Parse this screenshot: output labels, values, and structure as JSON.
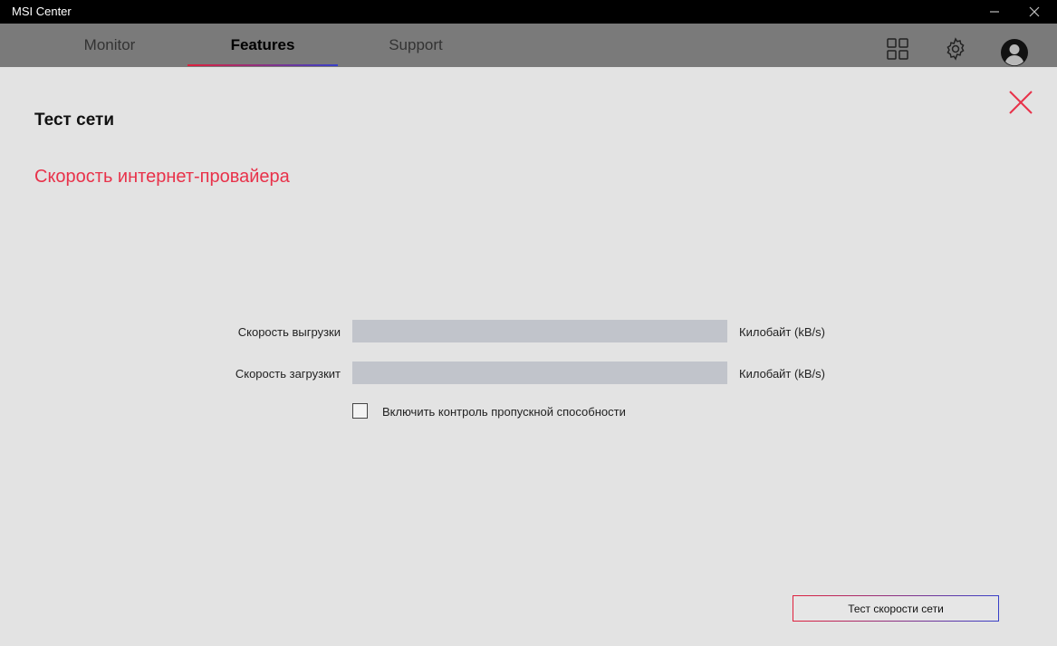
{
  "window": {
    "title": "MSI Center"
  },
  "nav": {
    "tabs": [
      {
        "label": "Monitor"
      },
      {
        "label": "Features",
        "active": true
      },
      {
        "label": "Support"
      }
    ],
    "icons": [
      "apps-grid-icon",
      "gear-icon",
      "avatar-icon"
    ],
    "accent_colors": [
      "#e0203c",
      "#3840c8"
    ]
  },
  "page": {
    "title": "Тест сети",
    "section_title": "Скорость интернет-провайера",
    "section_color": "#e8324a"
  },
  "form": {
    "upload_label": "Скорость выгрузки",
    "upload_value": "",
    "upload_unit": "Килобайт (kB/s)",
    "download_label": "Скорость загрузкит",
    "download_value": "",
    "download_unit": "Килобайт (kB/s)",
    "checkbox_label": "Включить контроль пропускной способности",
    "checkbox_checked": false
  },
  "actions": {
    "speed_test_label": "Тест скорости сети"
  }
}
